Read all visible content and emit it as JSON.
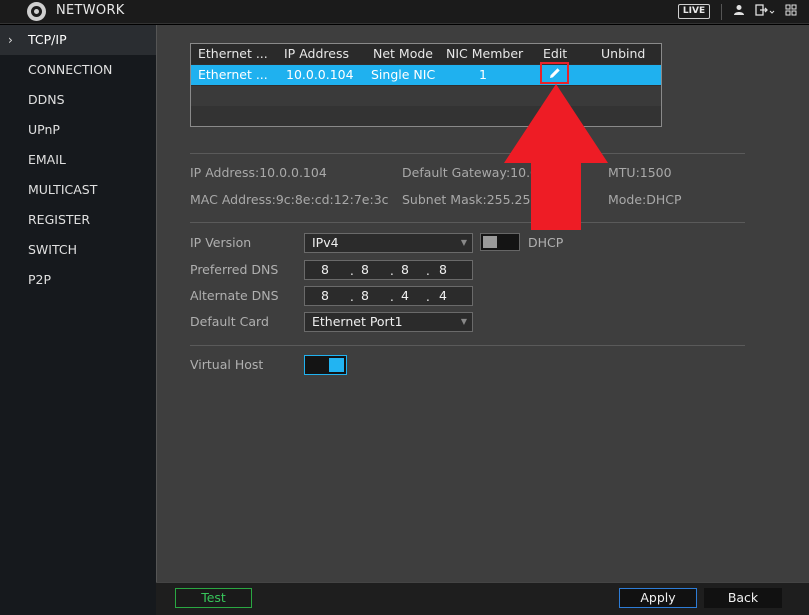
{
  "titlebar": {
    "title": "NETWORK",
    "live_label": "LIVE",
    "icons": [
      "user-icon",
      "logout-icon",
      "menu-grid-icon"
    ]
  },
  "sidebar": {
    "items": [
      {
        "label": "TCP/IP",
        "active": true
      },
      {
        "label": "CONNECTION"
      },
      {
        "label": "DDNS"
      },
      {
        "label": "UPnP"
      },
      {
        "label": "EMAIL"
      },
      {
        "label": "MULTICAST"
      },
      {
        "label": "REGISTER"
      },
      {
        "label": "SWITCH"
      },
      {
        "label": "P2P"
      }
    ]
  },
  "table": {
    "headers": [
      "Ethernet ...",
      "IP Address",
      "Net Mode",
      "NIC Member",
      "Edit",
      "Unbind"
    ],
    "rows": [
      {
        "ethernet": "Ethernet ...",
        "ip": "10.0.0.104",
        "mode": "Single NIC",
        "member": "1",
        "edit": "edit-icon",
        "unbind": ""
      }
    ]
  },
  "info": {
    "ip_address": {
      "label": "IP Address:",
      "value": "10.0.0.104"
    },
    "default_gateway": {
      "label": "Default Gateway:",
      "value": "10.0"
    },
    "mtu": {
      "label": "MTU:",
      "value": "1500"
    },
    "mac_address": {
      "label": "MAC Address:",
      "value": "9c:8e:cd:12:7e:3c"
    },
    "subnet_mask": {
      "label": "Subnet Mask:",
      "value": "255.255"
    },
    "mode": {
      "label": "Mode:",
      "value": "DHCP"
    }
  },
  "form": {
    "ip_version": {
      "label": "IP Version",
      "value": "IPv4"
    },
    "dhcp": {
      "label": "DHCP",
      "enabled": false
    },
    "preferred_dns": {
      "label": "Preferred DNS",
      "octets": [
        "8",
        "8",
        "8",
        "8"
      ]
    },
    "alternate_dns": {
      "label": "Alternate DNS",
      "octets": [
        "8",
        "8",
        "4",
        "4"
      ]
    },
    "default_card": {
      "label": "Default Card",
      "value": "Ethernet Port1"
    },
    "virtual_host": {
      "label": "Virtual Host",
      "enabled": true
    }
  },
  "footer": {
    "test_label": "Test",
    "apply_label": "Apply",
    "back_label": "Back"
  },
  "colors": {
    "selection": "#1fb1ef",
    "highlight_box": "#e8232a",
    "arrow": "#ee1c25",
    "test_button": "#2aa742",
    "apply_border": "#2d7cd6"
  }
}
